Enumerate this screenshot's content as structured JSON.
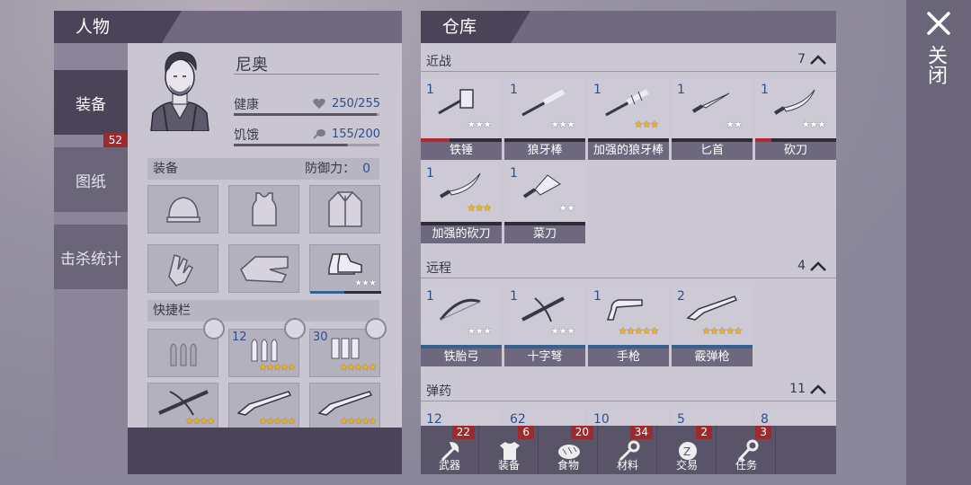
{
  "character": {
    "header": "人物",
    "tabs": [
      {
        "label": "装备",
        "active": true
      },
      {
        "label": "图纸",
        "badge": "52"
      },
      {
        "label": "击杀统计"
      }
    ],
    "name": "尼奥",
    "health": {
      "label": "健康",
      "value": "250/255",
      "fraction": 0.98
    },
    "hunger": {
      "label": "饥饿",
      "value": "155/200",
      "fraction": 0.78
    },
    "equipment": {
      "title": "装备",
      "defense_label": "防御力：",
      "defense_value": "0",
      "slots": [
        "hat",
        "shirt",
        "jacket",
        "gloves",
        "pants",
        "shoes"
      ],
      "shoes_stars": "★★★"
    },
    "quickbar": {
      "title": "快捷栏",
      "ammo": [
        {
          "count": "",
          "stars": ""
        },
        {
          "count": "12",
          "stars": "★★★★★"
        },
        {
          "count": "30",
          "stars": "★★★★★"
        }
      ],
      "weapons": [
        {
          "name": "crossbow",
          "stars": "★★★★"
        },
        {
          "name": "shotgun",
          "stars": "★★★★★"
        },
        {
          "name": "shotgun",
          "stars": "★★★★★"
        }
      ]
    }
  },
  "warehouse": {
    "header": "仓库",
    "categories": [
      {
        "name": "近战",
        "count": "7",
        "items": [
          {
            "qty": "1",
            "name": "铁锤",
            "stars": "★★★",
            "gold": false,
            "bar_color": "#b02a2f",
            "bar": 0.35
          },
          {
            "qty": "1",
            "name": "狼牙棒",
            "stars": "★★★",
            "gold": false,
            "bar_color": "#35618e",
            "bar": 0
          },
          {
            "qty": "1",
            "name": "加强的狼牙棒",
            "stars": "★★★",
            "gold": true,
            "bar_color": "#35618e",
            "bar": 0
          },
          {
            "qty": "1",
            "name": "匕首",
            "stars": "★★",
            "gold": false,
            "bar_color": "#35618e",
            "bar": 0
          },
          {
            "qty": "1",
            "name": "砍刀",
            "stars": "★★★",
            "gold": false,
            "bar_color": "#b02a2f",
            "bar": 0.2
          },
          {
            "qty": "1",
            "name": "加强的砍刀",
            "stars": "★★★",
            "gold": true,
            "bar_color": "#35618e",
            "bar": 0
          },
          {
            "qty": "1",
            "name": "菜刀",
            "stars": "★★",
            "gold": false,
            "bar_color": "#35618e",
            "bar": 0
          }
        ]
      },
      {
        "name": "远程",
        "count": "4",
        "items": [
          {
            "qty": "1",
            "name": "铁胎弓",
            "stars": "★★★",
            "gold": false,
            "bar_color": "#35618e",
            "bar": 1
          },
          {
            "qty": "1",
            "name": "十字弩",
            "stars": "★★★",
            "gold": false,
            "bar_color": "#35618e",
            "bar": 1
          },
          {
            "qty": "1",
            "name": "手枪",
            "stars": "★★★★★",
            "gold": true,
            "bar_color": "#35618e",
            "bar": 1
          },
          {
            "qty": "2",
            "name": "霰弹枪",
            "stars": "★★★★★",
            "gold": true,
            "bar_color": "#35618e",
            "bar": 1
          }
        ]
      },
      {
        "name": "弹药",
        "count": "11",
        "items": [
          {
            "qty": "12"
          },
          {
            "qty": "62"
          },
          {
            "qty": "10"
          },
          {
            "qty": "5"
          },
          {
            "qty": "8"
          }
        ]
      }
    ],
    "bottom_tabs": [
      {
        "label": "武器",
        "badge": "22",
        "icon": "axe-icon"
      },
      {
        "label": "装备",
        "badge": "6",
        "icon": "shirt-icon"
      },
      {
        "label": "食物",
        "badge": "20",
        "icon": "bread-icon"
      },
      {
        "label": "材料",
        "badge": "34",
        "icon": "wrench-icon"
      },
      {
        "label": "交易",
        "badge": "2",
        "icon": "coin-icon"
      },
      {
        "label": "任务",
        "badge": "3",
        "icon": "key-icon"
      }
    ]
  },
  "close": {
    "label": "关闭"
  }
}
